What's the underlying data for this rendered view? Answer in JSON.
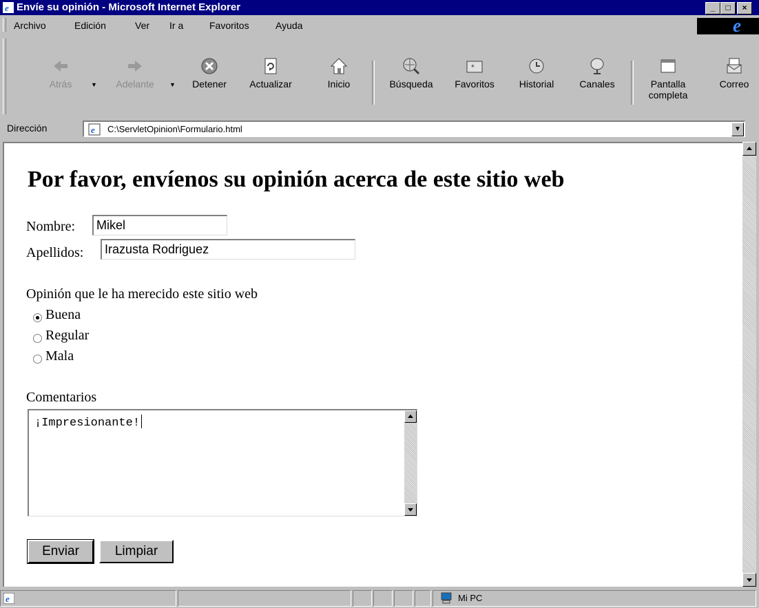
{
  "window": {
    "title": "Envíe su opinión - Microsoft Internet Explorer",
    "buttons": [
      "_",
      "□",
      "×"
    ]
  },
  "menu": [
    "Archivo",
    "Edición",
    "Ver",
    "Ir a",
    "Favoritos",
    "Ayuda"
  ],
  "toolbar": {
    "back": "Atrás",
    "forward": "Adelante",
    "stop": "Detener",
    "refresh": "Actualizar",
    "home": "Inicio",
    "search": "Búsqueda",
    "favorites": "Favoritos",
    "history": "Historial",
    "channels": "Canales",
    "fullscreen_1": "Pantalla",
    "fullscreen_2": "completa",
    "mail": "Correo"
  },
  "address": {
    "label": "Dirección",
    "url": "C:\\ServletOpinion\\Formulario.html"
  },
  "page": {
    "heading": "Por favor, envíenos su opinión acerca de este sitio web",
    "name_label": "Nombre:",
    "name_value": "Mikel",
    "surname_label": "Apellidos:",
    "surname_value": "Irazusta Rodriguez",
    "opinion_label": "Opinión que le ha merecido este sitio web",
    "options": [
      "Buena",
      "Regular",
      "Mala"
    ],
    "selected_option": "Buena",
    "comments_label": "Comentarios",
    "comments_value": "¡Impresionante!",
    "submit": "Enviar",
    "reset": "Limpiar"
  },
  "status": {
    "zone": "Mi PC"
  }
}
